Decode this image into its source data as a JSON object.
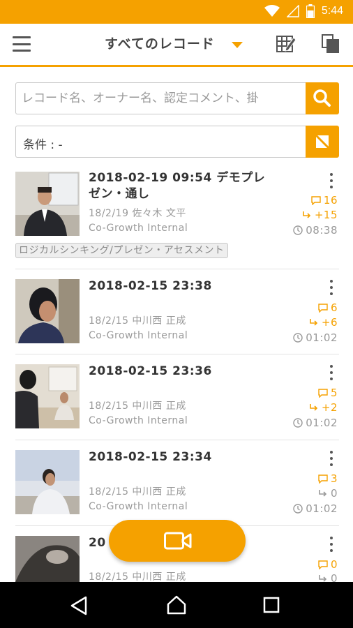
{
  "status_bar": {
    "time": "5:44",
    "icons": [
      "wifi-icon",
      "signal-icon",
      "battery-icon"
    ]
  },
  "app_bar": {
    "title": "すべてのレコード",
    "icons": [
      "menu-icon",
      "caret-down-icon",
      "grid-edit-icon",
      "copy-icon"
    ]
  },
  "search": {
    "placeholder": "レコード名、オーナー名、認定コメント、掛",
    "icon": "search-icon"
  },
  "filter": {
    "label": "条件 : -",
    "icon": "filter-clear-icon"
  },
  "records": [
    {
      "title": "2018-02-19 09:54 デモプレゼン・通し",
      "date_owner": "18/2/19 佐々木 文平",
      "org": "Co-Growth Internal",
      "comments": "16",
      "shares": "+15",
      "duration": "08:38",
      "tag": "ロジカルシンキング/プレゼン・アセスメント",
      "share_highlight": true
    },
    {
      "title": "2018-02-15 23:38",
      "date_owner": "18/2/15 中川西 正成",
      "org": "Co-Growth Internal",
      "comments": "6",
      "shares": "+6",
      "duration": "01:02",
      "share_highlight": true
    },
    {
      "title": "2018-02-15 23:36",
      "date_owner": "18/2/15 中川西 正成",
      "org": "Co-Growth Internal",
      "comments": "5",
      "shares": "+2",
      "duration": "01:02",
      "share_highlight": true
    },
    {
      "title": "2018-02-15 23:34",
      "date_owner": "18/2/15 中川西 正成",
      "org": "Co-Growth Internal",
      "comments": "3",
      "shares": "0",
      "duration": "01:02",
      "share_highlight": false
    },
    {
      "title": "20",
      "date_owner": "18/2/15 中川西 正成",
      "comments": "0",
      "shares": "0",
      "share_highlight": false
    }
  ],
  "fab": {
    "icon": "video-camera-icon"
  },
  "nav_bar": {
    "icons": [
      "back-icon",
      "home-icon",
      "recents-icon"
    ]
  },
  "colors": {
    "accent": "#f5a100",
    "nav": "#000000"
  }
}
